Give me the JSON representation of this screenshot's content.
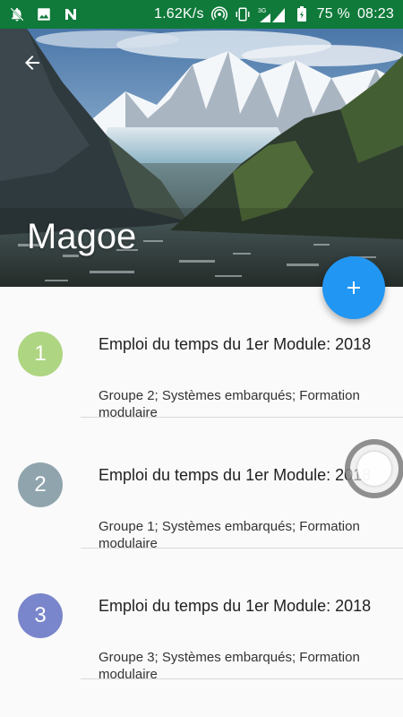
{
  "status_bar": {
    "speed": "1.62K/s",
    "network": "3G",
    "battery": "75 %",
    "time": "08:23",
    "icons": [
      "notifications-off-icon",
      "image-icon",
      "n-app-icon",
      "hotspot-icon",
      "vibrate-icon",
      "signal-icon",
      "signal-icon",
      "battery-icon"
    ]
  },
  "header": {
    "title": "Magoe",
    "back_icon": "arrow-back-icon"
  },
  "fab": {
    "icon": "plus-icon",
    "color": "#2196f3"
  },
  "list": {
    "items": [
      {
        "number": "1",
        "color": "#aed581",
        "title": "Emploi du temps du 1er Module: 2018",
        "subtitle": "Groupe 2; Systèmes embarqués; Formation modulaire"
      },
      {
        "number": "2",
        "color": "#90a4ae",
        "title": "Emploi du temps du 1er Module: 2018",
        "subtitle": "Groupe 1; Systèmes embarqués; Formation modulaire"
      },
      {
        "number": "3",
        "color": "#7986cb",
        "title": "Emploi du temps du 1er Module: 2018",
        "subtitle": "Groupe 3; Systèmes embarqués; Formation modulaire"
      }
    ]
  },
  "colors": {
    "status_bar": "#0f7a3a",
    "background": "#fafafa"
  }
}
